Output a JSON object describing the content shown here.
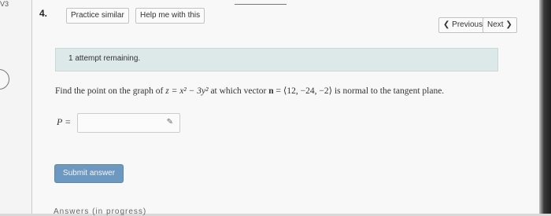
{
  "question": {
    "number": "4.",
    "text_parts": {
      "intro": "Find the point on the graph of ",
      "equation": "z = x² − 3y²",
      "middle": " at which vector ",
      "vector_name": "n",
      "vector_eq": " = ⟨12, −24, −2⟩",
      "end": " is normal to the tangent plane."
    },
    "answer_label": "P ="
  },
  "toolbar": {
    "practice_similar": "Practice similar",
    "help_me": "Help me with this",
    "previous": "❮ Previous",
    "next": "Next ❯"
  },
  "alert": {
    "attempts": "1 attempt remaining."
  },
  "answer": {
    "value": ""
  },
  "actions": {
    "submit": "Submit answer"
  },
  "footer": {
    "partial_text": "Answers (in progress)"
  },
  "icons": {
    "answer_tool": "pencil-icon"
  }
}
